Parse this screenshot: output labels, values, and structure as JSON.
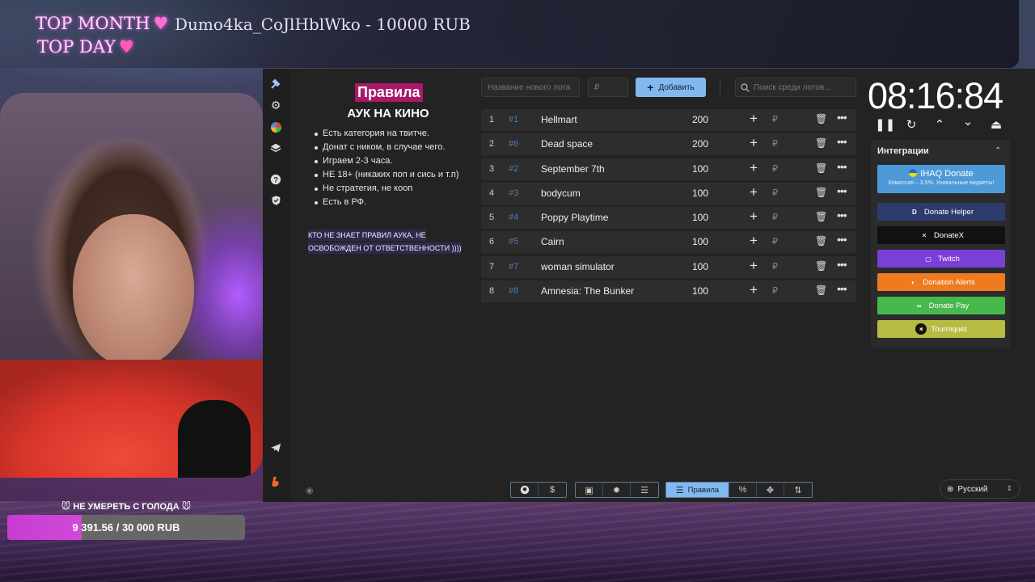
{
  "overlay": {
    "top_month_label": "TOP MONTH",
    "top_month_value": "Dumo4ka_CoJlHblWko - 10000 RUB",
    "top_day_label": "TOP DAY",
    "goal_title": "🐭 НЕ УМЕРЕТЬ С ГОЛОДА 🐭",
    "goal_text": "9 391.56 / 30 000 RUB",
    "goal_progress": 0.313
  },
  "rules": {
    "title": "Правила",
    "subtitle": "АУК НА КИНО",
    "items": [
      "Есть категория на твитче.",
      "Донат с ником, в случае чего.",
      "Играем 2-3 часа.",
      "НЕ 18+ (никаких поп и сись и т.п)",
      "Не стратегия, не кооп",
      "Есть в РФ."
    ],
    "warning": "КТО НЕ ЗНАЕТ ПРАВИЛ АУКА, НЕ ОСВОБОЖДЕН ОТ ОТВЕТСТВЕННОСТИ ))))"
  },
  "controls": {
    "new_lot_placeholder": "Название нового лота",
    "amount_placeholder": "₽",
    "add_label": "Добавить",
    "search_placeholder": "Поиск среди лотов..."
  },
  "lots": [
    {
      "num": "1",
      "id": "#1",
      "name": "Hellmart",
      "amount": "200"
    },
    {
      "num": "2",
      "id": "#6",
      "name": "Dead space",
      "amount": "200"
    },
    {
      "num": "3",
      "id": "#2",
      "name": "September 7th",
      "amount": "100"
    },
    {
      "num": "4",
      "id": "#3",
      "name": "bodycum",
      "amount": "100"
    },
    {
      "num": "5",
      "id": "#4",
      "name": "Poppy Playtime",
      "amount": "100"
    },
    {
      "num": "6",
      "id": "#5",
      "name": "Cairn",
      "amount": "100"
    },
    {
      "num": "7",
      "id": "#7",
      "name": "woman simulator",
      "amount": "100"
    },
    {
      "num": "8",
      "id": "#8",
      "name": "Amnesia: The Bunker",
      "amount": "100"
    }
  ],
  "lot_currency": "₽",
  "timer": "08:16:84",
  "integrations": {
    "title": "Интеграции",
    "ihaq_title": "IHAQ Donate",
    "ihaq_sub": "Комиссия – 3,5%. Уникальные виджеты!",
    "buttons": [
      {
        "label": "Donate Helper",
        "color": "#2d3a6e"
      },
      {
        "label": "DonateX",
        "color": "#111111"
      },
      {
        "label": "Twitch",
        "color": "#7b3fd6"
      },
      {
        "label": "Donation Alerts",
        "color": "#f07a1e"
      },
      {
        "label": "Donate Pay",
        "color": "#47b84c"
      },
      {
        "label": "Tourniquet",
        "color": "#b8bb42"
      }
    ]
  },
  "toolbar": {
    "rules_label": "Правила"
  },
  "language": "Русский"
}
